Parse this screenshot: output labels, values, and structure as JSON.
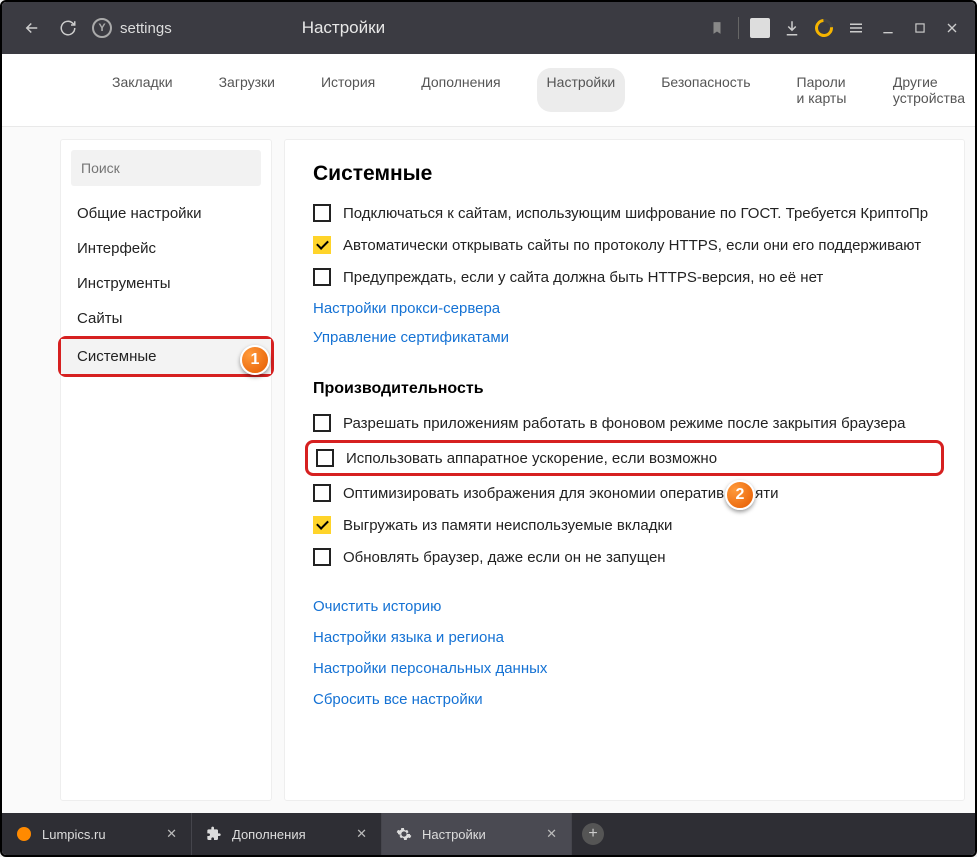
{
  "toolbar": {
    "address_label": "settings",
    "title": "Настройки"
  },
  "navtabs": [
    {
      "label": "Закладки"
    },
    {
      "label": "Загрузки"
    },
    {
      "label": "История"
    },
    {
      "label": "Дополнения"
    },
    {
      "label": "Настройки",
      "active": true
    },
    {
      "label": "Безопасность"
    },
    {
      "label": "Пароли и карты"
    },
    {
      "label": "Другие устройства"
    }
  ],
  "sidebar": {
    "search_placeholder": "Поиск",
    "items": [
      {
        "label": "Общие настройки"
      },
      {
        "label": "Интерфейс"
      },
      {
        "label": "Инструменты"
      },
      {
        "label": "Сайты"
      },
      {
        "label": "Системные",
        "selected": true,
        "highlighted": true
      }
    ]
  },
  "content": {
    "section1_title": "Системные",
    "opts1": [
      {
        "label": "Подключаться к сайтам, использующим шифрование по ГОСТ. Требуется КриптоПр",
        "checked": false
      },
      {
        "label": "Автоматически открывать сайты по протоколу HTTPS, если они его поддерживают",
        "checked": true
      },
      {
        "label": "Предупреждать, если у сайта должна быть HTTPS-версия, но её нет",
        "checked": false
      }
    ],
    "links1": [
      "Настройки прокси-сервера",
      "Управление сертификатами"
    ],
    "section2_title": "Производительность",
    "opts2": [
      {
        "label": "Разрешать приложениям работать в фоновом режиме после закрытия браузера",
        "checked": false
      },
      {
        "label": "Использовать аппаратное ускорение, если возможно",
        "checked": false,
        "highlighted": true
      },
      {
        "label": "Оптимизировать изображения для экономии оператив            памяти",
        "checked": false
      },
      {
        "label": "Выгружать из памяти неиспользуемые вкладки",
        "checked": true
      },
      {
        "label": "Обновлять браузер, даже если он не запущен",
        "checked": false
      }
    ],
    "links2": [
      "Очистить историю",
      "Настройки языка и региона",
      "Настройки персональных данных",
      "Сбросить все настройки"
    ]
  },
  "tabs": [
    {
      "label": "Lumpics.ru",
      "icon": "orange"
    },
    {
      "label": "Дополнения",
      "icon": "puzzle"
    },
    {
      "label": "Настройки",
      "icon": "gear",
      "active": true
    }
  ],
  "badges": {
    "b1": "1",
    "b2": "2"
  }
}
